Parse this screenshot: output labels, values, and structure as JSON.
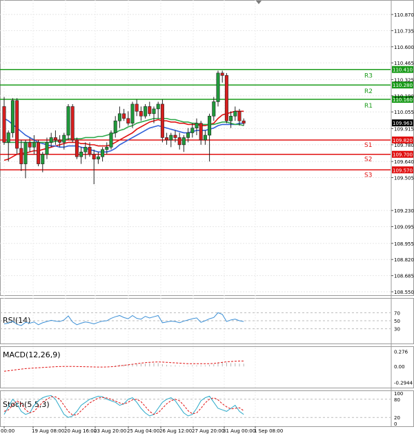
{
  "chart_data": {
    "type": "candlestick",
    "instrument": "USDJPY",
    "price_axis": {
      "ticks": [
        "110.870",
        "110.735",
        "110.600",
        "110.465",
        "110.325",
        "110.190",
        "110.055",
        "109.915",
        "109.780",
        "109.640",
        "109.505",
        "109.230",
        "109.095",
        "108.955",
        "108.820",
        "108.685",
        "108.550"
      ],
      "min": 108.55,
      "max": 110.87
    },
    "current_price": {
      "value": 109.963,
      "label": "109.963"
    },
    "levels": [
      {
        "name": "R3",
        "value": 110.41,
        "label": "110.410",
        "color": "#1a9b1a"
      },
      {
        "name": "R2",
        "value": 110.28,
        "label": "110.280",
        "color": "#1a9b1a"
      },
      {
        "name": "R1",
        "value": 110.16,
        "label": "110.160",
        "color": "#1a9b1a"
      },
      {
        "name": "S1",
        "value": 109.82,
        "label": "109.820",
        "color": "#e01010"
      },
      {
        "name": "S2",
        "value": 109.7,
        "label": "109.700",
        "color": "#e01010"
      },
      {
        "name": "S3",
        "value": 109.57,
        "label": "109.570",
        "color": "#e01010"
      }
    ],
    "x_labels": [
      "00:00",
      "19 Aug 08:00",
      "20 Aug 16:00",
      "23 Aug 20:00",
      "25 Aug 04:00",
      "26 Aug 12:00",
      "27 Aug 20:00",
      "31 Aug 00:00",
      "1 Sep 08:00"
    ],
    "candles": [
      {
        "o": 110.1,
        "h": 110.18,
        "l": 109.78,
        "c": 109.8
      },
      {
        "o": 109.8,
        "h": 109.9,
        "l": 109.64,
        "c": 109.88
      },
      {
        "o": 109.88,
        "h": 110.17,
        "l": 109.84,
        "c": 110.15
      },
      {
        "o": 110.15,
        "h": 110.17,
        "l": 109.7,
        "c": 109.75
      },
      {
        "o": 109.75,
        "h": 109.82,
        "l": 109.56,
        "c": 109.62
      },
      {
        "o": 109.62,
        "h": 109.82,
        "l": 109.5,
        "c": 109.8
      },
      {
        "o": 109.8,
        "h": 109.84,
        "l": 109.72,
        "c": 109.76
      },
      {
        "o": 109.76,
        "h": 109.86,
        "l": 109.7,
        "c": 109.8
      },
      {
        "o": 109.8,
        "h": 109.82,
        "l": 109.6,
        "c": 109.62
      },
      {
        "o": 109.62,
        "h": 109.72,
        "l": 109.55,
        "c": 109.7
      },
      {
        "o": 109.7,
        "h": 109.84,
        "l": 109.66,
        "c": 109.8
      },
      {
        "o": 109.8,
        "h": 109.88,
        "l": 109.76,
        "c": 109.84
      },
      {
        "o": 109.84,
        "h": 109.9,
        "l": 109.78,
        "c": 109.82
      },
      {
        "o": 109.82,
        "h": 109.86,
        "l": 109.76,
        "c": 109.8
      },
      {
        "o": 109.8,
        "h": 109.88,
        "l": 109.74,
        "c": 109.86
      },
      {
        "o": 109.86,
        "h": 110.12,
        "l": 109.82,
        "c": 110.1
      },
      {
        "o": 110.1,
        "h": 110.12,
        "l": 109.8,
        "c": 109.82
      },
      {
        "o": 109.82,
        "h": 109.84,
        "l": 109.66,
        "c": 109.68
      },
      {
        "o": 109.68,
        "h": 109.76,
        "l": 109.62,
        "c": 109.72
      },
      {
        "o": 109.72,
        "h": 109.8,
        "l": 109.66,
        "c": 109.76
      },
      {
        "o": 109.76,
        "h": 109.8,
        "l": 109.68,
        "c": 109.7
      },
      {
        "o": 109.7,
        "h": 109.74,
        "l": 109.45,
        "c": 109.66
      },
      {
        "o": 109.66,
        "h": 109.72,
        "l": 109.62,
        "c": 109.68
      },
      {
        "o": 109.68,
        "h": 109.76,
        "l": 109.64,
        "c": 109.74
      },
      {
        "o": 109.74,
        "h": 109.8,
        "l": 109.7,
        "c": 109.76
      },
      {
        "o": 109.76,
        "h": 109.9,
        "l": 109.74,
        "c": 109.88
      },
      {
        "o": 109.88,
        "h": 110.02,
        "l": 109.84,
        "c": 109.98
      },
      {
        "o": 109.98,
        "h": 110.1,
        "l": 109.92,
        "c": 110.04
      },
      {
        "o": 110.04,
        "h": 110.08,
        "l": 109.98,
        "c": 110.0
      },
      {
        "o": 110.0,
        "h": 110.06,
        "l": 109.94,
        "c": 109.96
      },
      {
        "o": 109.96,
        "h": 110.14,
        "l": 109.92,
        "c": 110.12
      },
      {
        "o": 110.12,
        "h": 110.16,
        "l": 110.02,
        "c": 110.06
      },
      {
        "o": 110.06,
        "h": 110.1,
        "l": 109.98,
        "c": 110.02
      },
      {
        "o": 110.02,
        "h": 110.12,
        "l": 110.0,
        "c": 110.1
      },
      {
        "o": 110.1,
        "h": 110.14,
        "l": 110.02,
        "c": 110.04
      },
      {
        "o": 110.04,
        "h": 110.1,
        "l": 109.96,
        "c": 110.08
      },
      {
        "o": 110.08,
        "h": 110.14,
        "l": 110.0,
        "c": 110.12
      },
      {
        "o": 110.12,
        "h": 110.16,
        "l": 109.8,
        "c": 109.84
      },
      {
        "o": 109.84,
        "h": 109.88,
        "l": 109.78,
        "c": 109.82
      },
      {
        "o": 109.82,
        "h": 109.88,
        "l": 109.76,
        "c": 109.86
      },
      {
        "o": 109.86,
        "h": 109.9,
        "l": 109.8,
        "c": 109.84
      },
      {
        "o": 109.84,
        "h": 109.88,
        "l": 109.74,
        "c": 109.78
      },
      {
        "o": 109.78,
        "h": 109.86,
        "l": 109.72,
        "c": 109.84
      },
      {
        "o": 109.84,
        "h": 109.92,
        "l": 109.8,
        "c": 109.88
      },
      {
        "o": 109.88,
        "h": 109.96,
        "l": 109.84,
        "c": 109.92
      },
      {
        "o": 109.92,
        "h": 110.0,
        "l": 109.86,
        "c": 109.96
      },
      {
        "o": 109.96,
        "h": 109.98,
        "l": 109.78,
        "c": 109.82
      },
      {
        "o": 109.82,
        "h": 109.9,
        "l": 109.78,
        "c": 109.86
      },
      {
        "o": 109.86,
        "h": 110.04,
        "l": 109.64,
        "c": 110.02
      },
      {
        "o": 110.02,
        "h": 110.18,
        "l": 109.98,
        "c": 110.14
      },
      {
        "o": 110.14,
        "h": 110.4,
        "l": 110.1,
        "c": 110.38
      },
      {
        "o": 110.38,
        "h": 110.4,
        "l": 110.3,
        "c": 110.36
      },
      {
        "o": 110.36,
        "h": 110.38,
        "l": 109.96,
        "c": 109.98
      },
      {
        "o": 109.98,
        "h": 110.06,
        "l": 109.92,
        "c": 110.02
      },
      {
        "o": 110.02,
        "h": 110.1,
        "l": 109.98,
        "c": 110.06
      },
      {
        "o": 110.06,
        "h": 110.08,
        "l": 109.94,
        "c": 109.98
      },
      {
        "o": 109.98,
        "h": 110.0,
        "l": 109.94,
        "c": 109.96
      }
    ],
    "series": [
      {
        "values": [
          109.65,
          109.66,
          109.68,
          109.7,
          109.71,
          109.71,
          109.72,
          109.73,
          109.73,
          109.74,
          109.75,
          109.76,
          109.77,
          109.78,
          109.79,
          109.8,
          109.8,
          109.8,
          109.79,
          109.79,
          109.78,
          109.78,
          109.77,
          109.77,
          109.77,
          109.78,
          109.8,
          109.82,
          109.84,
          109.86,
          109.88,
          109.91,
          109.93,
          109.95,
          109.97,
          109.98,
          109.99,
          109.98,
          109.98,
          109.97,
          109.97,
          109.96,
          109.96,
          109.95,
          109.95,
          109.95,
          109.94,
          109.94,
          109.95,
          109.96,
          110.0,
          110.03,
          110.04,
          110.05,
          110.06,
          110.06,
          110.06
        ]
      },
      {
        "values": [
          110.0,
          109.98,
          109.95,
          109.92,
          109.89,
          109.86,
          109.84,
          109.82,
          109.8,
          109.79,
          109.78,
          109.77,
          109.77,
          109.76,
          109.76,
          109.77,
          109.77,
          109.77,
          109.76,
          109.75,
          109.74,
          109.73,
          109.72,
          109.72,
          109.72,
          109.73,
          109.75,
          109.78,
          109.8,
          109.82,
          109.84,
          109.86,
          109.88,
          109.9,
          109.92,
          109.93,
          109.94,
          109.93,
          109.92,
          109.91,
          109.9,
          109.89,
          109.88,
          109.88,
          109.89,
          109.9,
          109.9,
          109.9,
          109.91,
          109.92,
          109.94,
          109.95,
          109.95,
          109.95,
          109.95,
          109.96,
          109.96
        ]
      },
      {
        "values": [
          109.8,
          109.8,
          109.8,
          109.8,
          109.8,
          109.8,
          109.8,
          109.8,
          109.8,
          109.8,
          109.8,
          109.8,
          109.81,
          109.81,
          109.82,
          109.83,
          109.83,
          109.83,
          109.83,
          109.84,
          109.84,
          109.84,
          109.85,
          109.85,
          109.86,
          109.87,
          109.88,
          109.9,
          109.91,
          109.93,
          109.94,
          109.96,
          109.97,
          109.98,
          109.99,
          110.0,
          110.0,
          110.0,
          110.0,
          109.99,
          109.99,
          109.98,
          109.97,
          109.97,
          109.96,
          109.96,
          109.95,
          109.95,
          109.95,
          109.95,
          109.96,
          109.97,
          109.97,
          109.96,
          109.95,
          109.95,
          109.94
        ]
      }
    ],
    "rsi": {
      "label": "RSI(14)",
      "ticks": [
        "70",
        "50",
        "30"
      ],
      "ylim": [
        0,
        100
      ],
      "values": [
        42,
        44,
        49,
        41,
        38,
        46,
        44,
        47,
        40,
        45,
        48,
        51,
        49,
        48,
        52,
        62,
        47,
        40,
        44,
        47,
        45,
        42,
        46,
        49,
        50,
        56,
        60,
        63,
        58,
        55,
        63,
        56,
        54,
        61,
        57,
        60,
        63,
        45,
        47,
        49,
        48,
        45,
        49,
        52,
        55,
        57,
        46,
        50,
        55,
        58,
        70,
        66,
        48,
        52,
        54,
        50,
        48
      ]
    },
    "macd": {
      "label": "MACD(12,26,9)",
      "ticks": [
        "0.276",
        "0.00",
        "-0.2944"
      ],
      "ylim": [
        -0.34,
        0.32
      ],
      "hist": [
        0,
        0,
        0,
        0,
        0,
        0,
        0,
        0,
        0,
        0,
        0,
        0,
        0,
        0,
        0,
        0,
        0,
        0,
        0,
        0,
        0,
        0,
        0,
        0,
        0,
        0,
        0.02,
        0.03,
        0.03,
        0.04,
        0.04,
        0.05,
        0.05,
        0.05,
        0.06,
        0.06,
        0.06,
        0.04,
        0.03,
        0.02,
        0.02,
        0.01,
        0.01,
        0.01,
        0.02,
        0.02,
        0.02,
        0.02,
        0.03,
        0.04,
        0.07,
        0.08,
        0.07,
        0.06,
        0.06,
        0.05,
        0.05
      ],
      "signal": [
        -0.09,
        -0.08,
        -0.07,
        -0.06,
        -0.05,
        -0.04,
        -0.035,
        -0.03,
        -0.025,
        -0.02,
        -0.015,
        -0.01,
        -0.005,
        -0.002,
        0.0,
        0.0,
        0.0,
        -0.002,
        -0.004,
        -0.006,
        -0.008,
        -0.01,
        -0.012,
        -0.012,
        -0.01,
        -0.006,
        0.0,
        0.01,
        0.02,
        0.03,
        0.04,
        0.05,
        0.06,
        0.07,
        0.075,
        0.08,
        0.082,
        0.08,
        0.075,
        0.07,
        0.065,
        0.06,
        0.055,
        0.05,
        0.05,
        0.05,
        0.05,
        0.05,
        0.05,
        0.055,
        0.065,
        0.075,
        0.085,
        0.09,
        0.095,
        0.1,
        0.1
      ]
    },
    "stoch": {
      "label": "Stoch(5,5,3)",
      "ticks": [
        "100",
        "80",
        "20",
        "0"
      ],
      "ylim": [
        0,
        100
      ],
      "main": [
        30,
        55,
        80,
        65,
        40,
        30,
        35,
        60,
        75,
        85,
        90,
        92,
        80,
        55,
        30,
        20,
        25,
        40,
        60,
        70,
        80,
        85,
        90,
        88,
        80,
        75,
        70,
        60,
        65,
        80,
        85,
        70,
        50,
        35,
        25,
        30,
        50,
        70,
        80,
        85,
        75,
        55,
        35,
        25,
        30,
        50,
        75,
        85,
        90,
        70,
        50,
        45,
        40,
        50,
        60,
        40,
        30
      ],
      "signal": [
        40,
        45,
        60,
        75,
        65,
        45,
        35,
        40,
        55,
        70,
        80,
        88,
        88,
        80,
        60,
        40,
        28,
        28,
        42,
        55,
        68,
        76,
        84,
        86,
        84,
        80,
        74,
        68,
        64,
        70,
        78,
        80,
        72,
        56,
        40,
        30,
        35,
        50,
        65,
        75,
        80,
        75,
        60,
        42,
        32,
        35,
        50,
        68,
        80,
        85,
        78,
        65,
        55,
        48,
        50,
        52,
        42
      ]
    }
  }
}
